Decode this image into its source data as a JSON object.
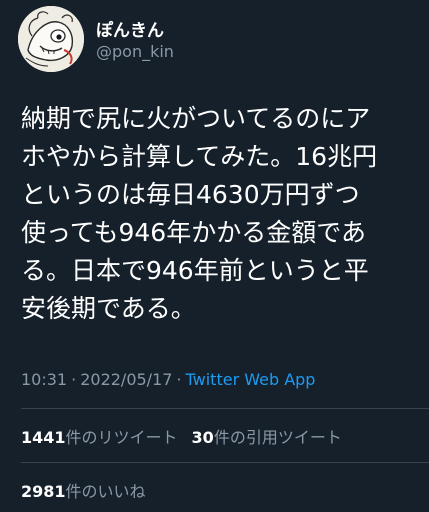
{
  "user": {
    "display_name": "ぽんきん",
    "handle": "@pon_kin"
  },
  "tweet": {
    "lines": [
      "納期で尻に火がついてるのにア",
      "ホやから計算してみた。16兆円",
      "というのは毎日4630万円ずつ",
      "使っても946年かかる金額であ",
      "る。日本で946年前というと平",
      "安後期である。"
    ]
  },
  "meta": {
    "time": "10:31",
    "separator": "·",
    "date": "2022/05/17",
    "app": "Twitter Web App"
  },
  "stats": {
    "retweets_count": "1441",
    "retweets_label": "件のリツイート",
    "quotes_count": "30",
    "quotes_label": "件の引用ツイート",
    "likes_count": "2981",
    "likes_label": "件のいいね"
  },
  "colors": {
    "background": "#15202b",
    "text": "#ffffff",
    "secondary": "#8b98a5",
    "link": "#1d9bf0",
    "divider": "#38444d"
  },
  "icons": {
    "avatar": "avatar-illustration"
  }
}
